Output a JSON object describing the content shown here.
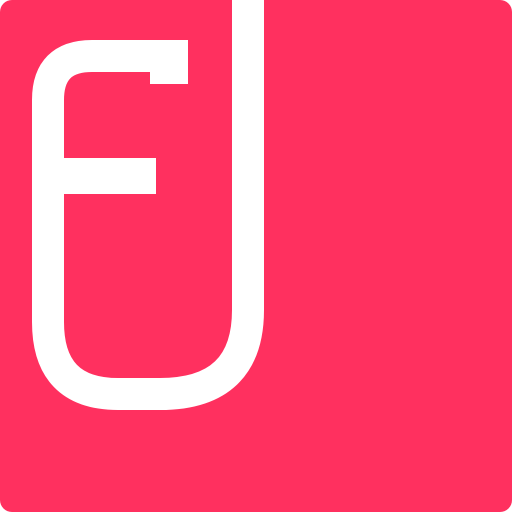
{
  "icon": {
    "name": "app-logo-icon",
    "brand_letters": "FJ",
    "background_color": "#FF305F",
    "glyph_color": "#FFFFFF"
  }
}
